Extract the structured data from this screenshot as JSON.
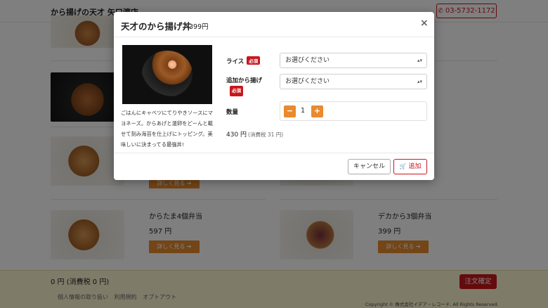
{
  "header": {
    "shop_name": "から揚げの天才 矢口渡店",
    "phone": "03-5732-1172",
    "phone_icon": "phone-icon"
  },
  "menu": {
    "items": [
      {
        "name": "からたま4個弁当",
        "price": "597 円",
        "detail_label": "詳しく見る ➔"
      },
      {
        "name": "デカから3個弁当",
        "price": "399 円",
        "detail_label": "詳しく見る ➔"
      },
      {
        "detail_label": "詳しく見る ➔"
      }
    ]
  },
  "footer": {
    "total": "0 円 (消費税 0 円)",
    "order_label": "注文確定",
    "links": [
      "個人情報の取り扱い",
      "利用規約",
      "オプトアウト"
    ],
    "copyright": "Copyright © 株式会社イデア・レコード. All Rights Reserved."
  },
  "modal": {
    "title": "天才のから揚げ丼",
    "price": "399円",
    "close": "×",
    "description": "ごはんにキャベツにてりやきソースにマヨネーズ。からあげと温卵をどーんと載せて刻み海苔を仕上げにトッピング。美味しいに決まってる最強丼!",
    "rice_label": "ライス",
    "topping_label": "追加から揚げ",
    "required_badge": "必須",
    "select_placeholder": "お選びください",
    "qty_label": "数量",
    "qty_minus": "−",
    "qty_value": "1",
    "qty_plus": "+",
    "subtotal": "430 円",
    "subtotal_tax": "(消費税 31 円)",
    "cancel_label": "キャンセル",
    "add_label": "追加",
    "cart_icon": "cart-icon"
  }
}
